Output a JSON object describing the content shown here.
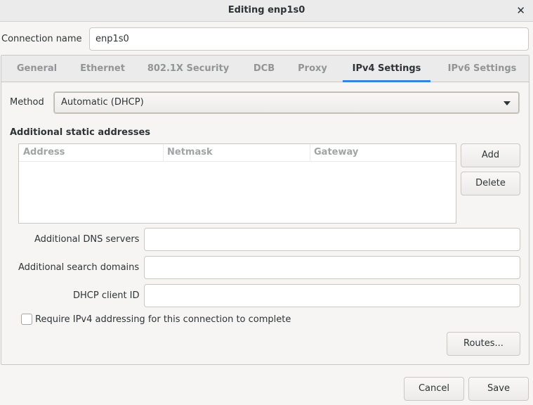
{
  "window": {
    "title": "Editing enp1s0"
  },
  "connection": {
    "label": "Connection name",
    "value": "enp1s0"
  },
  "tabs": [
    "General",
    "Ethernet",
    "802.1X Security",
    "DCB",
    "Proxy",
    "IPv4 Settings",
    "IPv6 Settings"
  ],
  "active_tab": "IPv4 Settings",
  "ipv4": {
    "method_label": "Method",
    "method_value": "Automatic (DHCP)",
    "static_title": "Additional static addresses",
    "columns": [
      "Address",
      "Netmask",
      "Gateway"
    ],
    "add_label": "Add",
    "delete_label": "Delete",
    "dns_label": "Additional DNS servers",
    "dns_value": "",
    "search_label": "Additional search domains",
    "search_value": "",
    "dhcp_label": "DHCP client ID",
    "dhcp_value": "",
    "require_label": "Require IPv4 addressing for this connection to complete",
    "require_checked": false,
    "routes_label": "Routes..."
  },
  "footer": {
    "cancel_label": "Cancel",
    "save_label": "Save"
  },
  "colors": {
    "accent": "#3584e4"
  }
}
